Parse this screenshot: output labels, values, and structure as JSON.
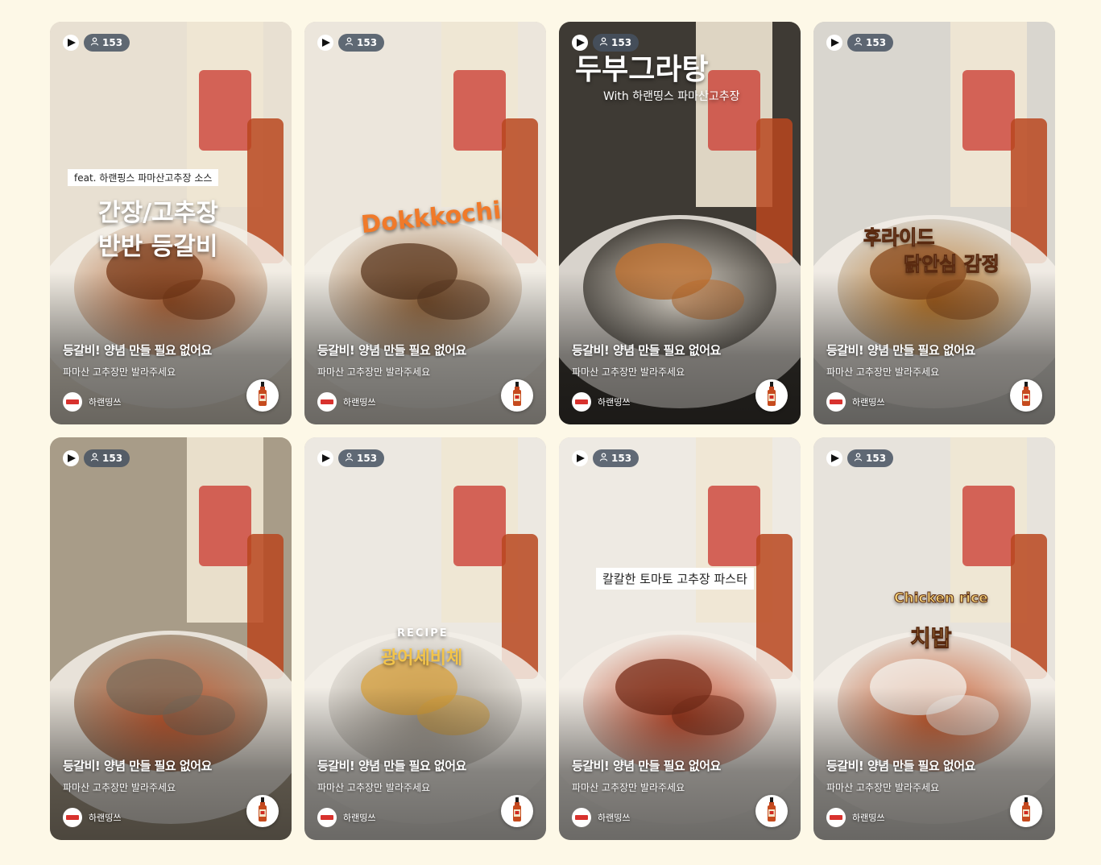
{
  "cards": [
    {
      "views": "153",
      "overlay_lines": [
        "feat. 하랜핑스 파마산고추장 소스",
        "간장/고추장",
        "반반 등갈비"
      ],
      "title": "등갈비! 양념 만들 필요 없어요",
      "subtitle": "파마산 고추장만 발라주세요",
      "brand": "하랜띵쓰",
      "bg_colors": [
        "#e8e0d2",
        "#b5683a",
        "#7a3a18"
      ]
    },
    {
      "views": "153",
      "overlay_lines": [
        "Dokkkochi"
      ],
      "title": "등갈비! 양념 만들 필요 없어요",
      "subtitle": "파마산 고추장만 발라주세요",
      "brand": "하랜띵쓰",
      "bg_colors": [
        "#ece6dc",
        "#9a6a3e",
        "#5c3a22"
      ]
    },
    {
      "views": "153",
      "overlay_lines": [
        "두부그라탕",
        "With 하랜띵스 파마산고추장"
      ],
      "title": "등갈비! 양념 만들 필요 없어요",
      "subtitle": "파마산 고추장만 발라주세요",
      "brand": "하랜띵쓰",
      "bg_colors": [
        "#3e3a34",
        "#e9e2d6",
        "#c4712e"
      ]
    },
    {
      "views": "153",
      "overlay_lines": [
        "후라이드",
        "닭안심 감정"
      ],
      "title": "등갈비! 양념 만들 필요 없어요",
      "subtitle": "파마산 고추장만 발라주세요",
      "brand": "하랜띵쓰",
      "bg_colors": [
        "#d9d6cf",
        "#c07a2a",
        "#8a4a1c"
      ]
    },
    {
      "views": "153",
      "overlay_lines": [],
      "title": "등갈비! 양념 만들 필요 없어요",
      "subtitle": "파마산 고추장만 발라주세요",
      "brand": "하랜띵쓰",
      "bg_colors": [
        "#a89c88",
        "#c2582e",
        "#7d6e5c"
      ]
    },
    {
      "views": "153",
      "overlay_lines": [
        "RECIPE",
        "광어세비체"
      ],
      "title": "등갈비! 양념 만들 필요 없어요",
      "subtitle": "파마산 고추장만 발라주세요",
      "brand": "하랜띵쓰",
      "bg_colors": [
        "#ece8e1",
        "#9d968c",
        "#d9a23c"
      ]
    },
    {
      "views": "153",
      "overlay_lines": [
        "칼칼한 토마토 고추장 파스타"
      ],
      "title": "등갈비! 양념 만들 필요 없어요",
      "subtitle": "파마산 고추장만 발라주세요",
      "brand": "하랜띵쓰",
      "bg_colors": [
        "#eeeae3",
        "#c24a2a",
        "#7a2e1a"
      ]
    },
    {
      "views": "153",
      "overlay_lines": [
        "Chicken rice",
        "치밥"
      ],
      "title": "등갈비! 양념 만들 필요 없어요",
      "subtitle": "파마산 고추장만 발라주세요",
      "brand": "하랜띵쓰",
      "bg_colors": [
        "#e7e3dc",
        "#c85a2c",
        "#f4f1ec"
      ]
    }
  ]
}
